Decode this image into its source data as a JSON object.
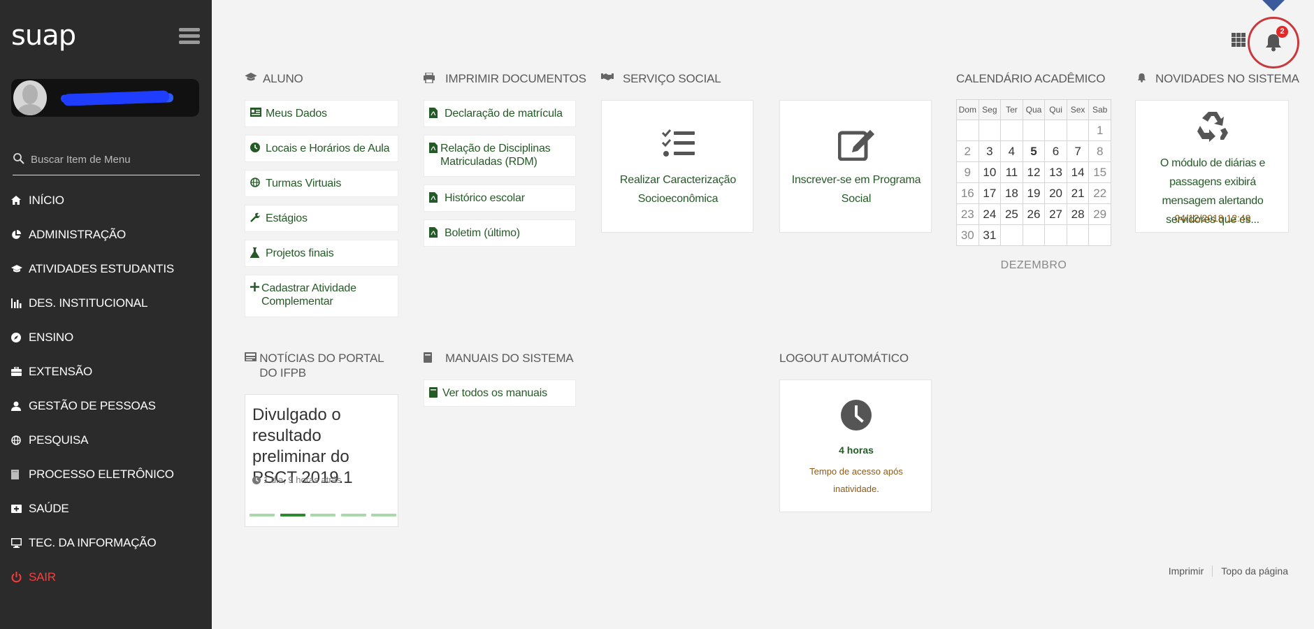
{
  "sidebar": {
    "logo": "suap",
    "search_placeholder": "Buscar Item de Menu",
    "items": [
      {
        "label": "INÍCIO"
      },
      {
        "label": "ADMINISTRAÇÃO"
      },
      {
        "label": "ATIVIDADES ESTUDANTIS"
      },
      {
        "label": "DES. INSTITUCIONAL"
      },
      {
        "label": "ENSINO"
      },
      {
        "label": "EXTENSÃO"
      },
      {
        "label": "GESTÃO DE PESSOAS"
      },
      {
        "label": "PESQUISA"
      },
      {
        "label": "PROCESSO ELETRÔNICO"
      },
      {
        "label": "SAÚDE"
      },
      {
        "label": "TEC. DA INFORMAÇÃO"
      },
      {
        "label": "SAIR"
      }
    ]
  },
  "topbar": {
    "notification_count": "2"
  },
  "aluno": {
    "title": "ALUNO",
    "links": [
      "Meus Dados",
      "Locais e Horários de Aula",
      "Turmas Virtuais",
      "Estágios",
      "Projetos finais",
      "Cadastrar Atividade Complementar"
    ]
  },
  "imprimir": {
    "title": "IMPRIMIR DOCUMENTOS",
    "links": [
      "Declaração de matrícula",
      "Relação de Disciplinas Matriculadas (RDM)",
      "Histórico escolar",
      "Boletim (último)"
    ]
  },
  "servico_social": {
    "title": "SERVIÇO SOCIAL",
    "cards": [
      "Realizar Caracterização Socioeconômica",
      "Inscrever-se em Programa Social"
    ]
  },
  "calendario": {
    "title": "CALENDÁRIO ACADÊMICO",
    "weekdays": [
      "Dom",
      "Seg",
      "Ter",
      "Qua",
      "Qui",
      "Sex",
      "Sab"
    ],
    "weeks": [
      [
        "",
        "",
        "",
        "",
        "",
        "",
        "1"
      ],
      [
        "2",
        "3",
        "4",
        "5",
        "6",
        "7",
        "8"
      ],
      [
        "9",
        "10",
        "11",
        "12",
        "13",
        "14",
        "15"
      ],
      [
        "16",
        "17",
        "18",
        "19",
        "20",
        "21",
        "22"
      ],
      [
        "23",
        "24",
        "25",
        "26",
        "27",
        "28",
        "29"
      ],
      [
        "30",
        "31",
        "",
        "",
        "",
        "",
        ""
      ]
    ],
    "today": "5",
    "month": "DEZEMBRO"
  },
  "novidades": {
    "title": "NOVIDADES NO SISTEMA",
    "text": "O módulo de diárias e passagens exibirá mensagem alertando servidores que es...",
    "date": "04/12/2018 12:49"
  },
  "noticias": {
    "title": "NOTÍCIAS DO PORTAL DO IFPB",
    "headline": "Divulgado o resultado preliminar do PSCT 2019.1",
    "time": "1 dia, 9 horas atrás",
    "slides": 5,
    "active_slide": 2
  },
  "manuais": {
    "title": "MANUAIS DO SISTEMA",
    "link": "Ver todos os manuais"
  },
  "logout": {
    "title": "LOGOUT AUTOMÁTICO",
    "value": "4 horas",
    "description": "Tempo de acesso após inatividade."
  },
  "footer": {
    "print": "Imprimir",
    "top": "Topo da página"
  },
  "colors": {
    "sidebar_bg": "#2b2b2b",
    "link_green": "#245a26",
    "alert_red": "#c9383b",
    "exit_red": "#ff3b3b"
  }
}
